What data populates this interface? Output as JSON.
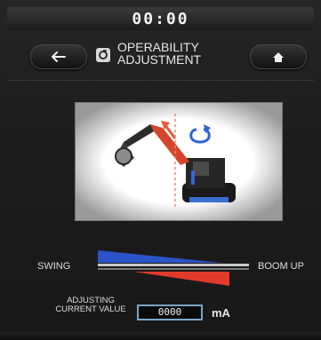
{
  "status": {
    "clock": "00:00"
  },
  "header": {
    "title_line1": "OPERABILITY",
    "title_line2": "ADJUSTMENT",
    "back_icon": "arrow-left",
    "home_icon": "home",
    "title_icon": "adjust"
  },
  "balance": {
    "left_label": "SWING",
    "right_label": "BOOM UP"
  },
  "adjust": {
    "label_line1": "ADJUSTING",
    "label_line2": "CURRENT VALUE",
    "value": "0000",
    "unit": "mA"
  },
  "colors": {
    "swing_indicator": "#2b54c9",
    "boom_indicator": "#e23a2a",
    "value_box_border": "#7aa7c9"
  }
}
